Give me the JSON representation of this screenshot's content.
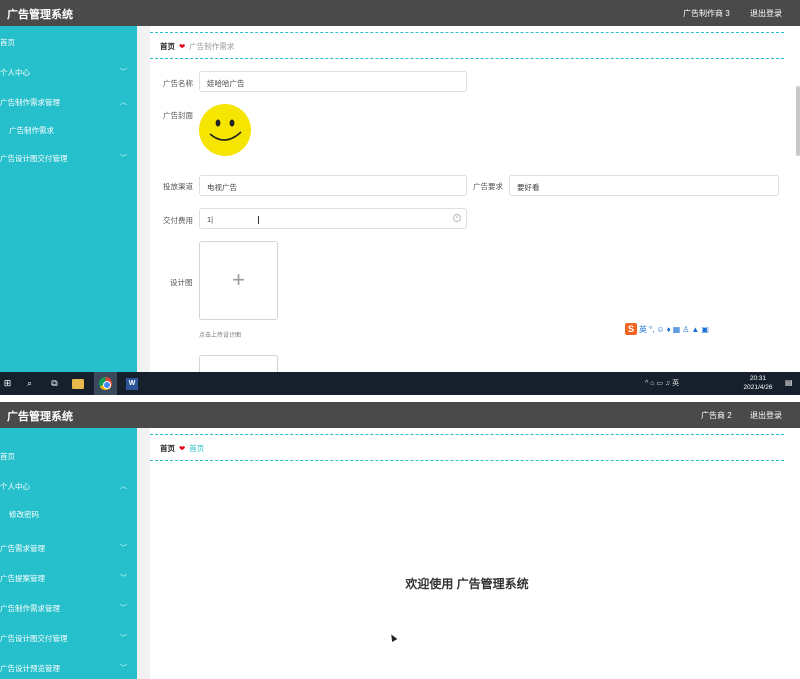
{
  "colors": {
    "topbar": "#4a4a4a",
    "sidebar": "#26c0cc",
    "accent": "#26c0cc",
    "heart": "#e60012",
    "taskbar": "#16202c"
  },
  "shot1": {
    "app_title": "广告管理系统",
    "user_label": "广告制作商 3",
    "logout_label": "退出登录",
    "sidebar": {
      "home": "首页",
      "personal_center": "个人中心",
      "production_demand_mgmt": "广告制作需求管理",
      "production_demand": "广告制作需求",
      "design_delivery_mgmt": "广告设计图交付管理"
    },
    "breadcrumb": {
      "home": "首页",
      "heart": "❤",
      "current": "广告制作需求"
    },
    "form": {
      "name_label": "广告名称",
      "name_value": "娃哈哈广告",
      "cover_label": "广告封面",
      "channel_label": "投放渠道",
      "channel_value": "电视广告",
      "requirement_label": "广告要求",
      "requirement_value": "要好看",
      "fee_label": "交付费用",
      "fee_value": "1|",
      "design_label": "设计图",
      "upload_plus": "+",
      "upload_hint": "点击上传设计图"
    },
    "ime_toolbar": {
      "logo": "S",
      "mode": "英"
    },
    "taskbar": {
      "tray": "^ ⌂ ▭ ♫ 英",
      "time": "20:31",
      "date": "2021/4/26"
    }
  },
  "shot2": {
    "app_title": "广告管理系统",
    "user_label": "广告商 2",
    "logout_label": "退出登录",
    "sidebar": {
      "home": "首页",
      "personal_center": "个人中心",
      "change_password": "修改密码",
      "demand_mgmt": "广告需求管理",
      "proposal_mgmt": "广告提案管理",
      "production_demand_mgmt": "广告制作需求管理",
      "design_delivery_mgmt": "广告设计图交付管理",
      "design_preview_mgmt": "广告设计预览管理"
    },
    "breadcrumb": {
      "home": "首页",
      "heart": "❤",
      "current": "首页"
    },
    "welcome": "欢迎使用 广告管理系统"
  }
}
